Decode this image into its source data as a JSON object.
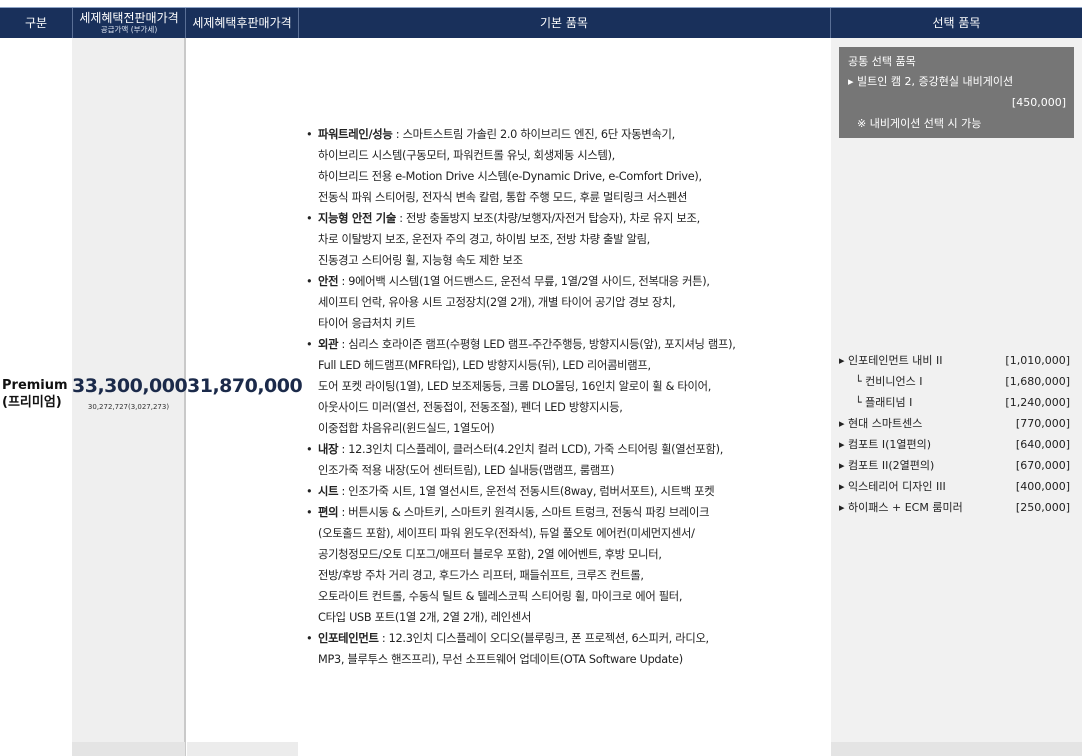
{
  "header": {
    "col_trim": "구분",
    "col_price_before": "세제혜택전판매가격",
    "col_price_before_sub": "공급가액 (부가세)",
    "col_price_after": "세제혜택후판매가격",
    "col_basic": "기본 품목",
    "col_option": "선택 품목"
  },
  "trim": {
    "name_en": "Premium",
    "name_ko": "(프리미엄)",
    "price_before": "33,300,000",
    "price_before_sub": "30,272,727(3,027,273)",
    "price_after": "31,870,000"
  },
  "basic_items": [
    {
      "title": "파워트레인/성능",
      "lines": [
        " : 스마트스트림 가솔린 2.0 하이브리드 엔진, 6단 자동변속기,",
        "하이브리드 시스템(구동모터, 파워컨트롤 유닛, 회생제동 시스템),",
        "하이브리드 전용 e-Motion Drive 시스템(e-Dynamic Drive, e-Comfort Drive),",
        "전동식 파워 스티어링, 전자식 변속 칼럼, 통합 주행 모드, 후륜 멀티링크 서스펜션"
      ]
    },
    {
      "title": "지능형 안전 기술",
      "lines": [
        " : 전방 충돌방지 보조(차량/보행자/자전거 탑승자), 차로 유지 보조,",
        "차로 이탈방지 보조, 운전자 주의 경고, 하이빔 보조, 전방 차량 출발 알림,",
        "진동경고 스티어링 휠, 지능형 속도 제한 보조"
      ]
    },
    {
      "title": "안전",
      "lines": [
        " : 9에어백 시스템(1열 어드밴스드, 운전석 무릎, 1열/2열 사이드, 전복대응 커튼),",
        "세이프티 언락, 유아용 시트 고정장치(2열 2개), 개별 타이어 공기압 경보 장치,",
        "타이어 응급처치 키트"
      ]
    },
    {
      "title": "외관",
      "lines": [
        " : 심리스 호라이즌 램프(수평형 LED 램프-주간주행등, 방향지시등(앞), 포지셔닝 램프),",
        "Full LED 헤드램프(MFR타입), LED 방향지시등(뒤), LED 리어콤비램프,",
        "도어 포켓 라이팅(1열), LED 보조제동등, 크롬 DLO몰딩, 16인치 알로이 휠 & 타이어,",
        "아웃사이드 미러(열선, 전동접이, 전동조절), 펜더 LED 방향지시등,",
        "이중접합 차음유리(윈드실드, 1열도어)"
      ]
    },
    {
      "title": "내장",
      "lines": [
        " : 12.3인치 디스플레이, 클러스터(4.2인치 컬러 LCD), 가죽 스티어링 휠(열선포함),",
        "인조가죽 적용 내장(도어 센터트림), LED 실내등(맵램프, 룸램프)"
      ]
    },
    {
      "title": "시트",
      "lines": [
        " : 인조가죽 시트, 1열 열선시트, 운전석 전동시트(8way, 럼버서포트), 시트백 포켓"
      ]
    },
    {
      "title": "편의",
      "lines": [
        " : 버튼시동 & 스마트키, 스마트키 원격시동, 스마트 트렁크, 전동식 파킹 브레이크",
        "(오토홀드 포함), 세이프티 파워 윈도우(전좌석), 듀얼 풀오토 에어컨(미세먼지센서/",
        "공기청정모드/오토 디포그/애프터 블로우 포함), 2열 에어벤트, 후방 모니터,",
        "전방/후방 주차 거리 경고, 후드가스 리프터, 패들쉬프트, 크루즈 컨트롤,",
        "오토라이트 컨트롤, 수동식 틸트 & 텔레스코픽 스티어링 휠, 마이크로 에어 필터,",
        "C타입 USB 포트(1열 2개, 2열 2개), 레인센서"
      ]
    },
    {
      "title": "인포테인먼트",
      "lines": [
        " : 12.3인치 디스플레이 오디오(블루링크, 폰 프로젝션, 6스피커, 라디오,",
        "MP3, 블루투스 핸즈프리), 무선 소프트웨어 업데이트(OTA Software Update)"
      ]
    }
  ],
  "common_options": {
    "title": "공통 선택 품목",
    "item": "▸ 빌트인 캠 2, 증강현실 내비게이션",
    "price": "[450,000]",
    "note": "※ 내비게이션 선택 시 가능"
  },
  "options": [
    {
      "name": "▸ 인포테인먼트 내비 II",
      "price": "[1,010,000]",
      "sub": false
    },
    {
      "name": "└ 컨비니언스 I",
      "price": "[1,680,000]",
      "sub": true
    },
    {
      "name": "└ 플래티넘 I",
      "price": "[1,240,000]",
      "sub": true
    },
    {
      "name": "▸ 현대 스마트센스",
      "price": "[770,000]",
      "sub": false
    },
    {
      "name": "▸ 컴포트 I(1열편의)",
      "price": "[640,000]",
      "sub": false
    },
    {
      "name": "▸ 컴포트 II(2열편의)",
      "price": "[670,000]",
      "sub": false
    },
    {
      "name": "▸ 익스테리어 디자인 III",
      "price": "[400,000]",
      "sub": false
    },
    {
      "name": "▸ 하이패스 + ECM 룸미러",
      "price": "[250,000]",
      "sub": false
    }
  ],
  "colors": {
    "header_bg": "#19305b",
    "column_gray": "#efefef",
    "option_box": "#767676"
  }
}
